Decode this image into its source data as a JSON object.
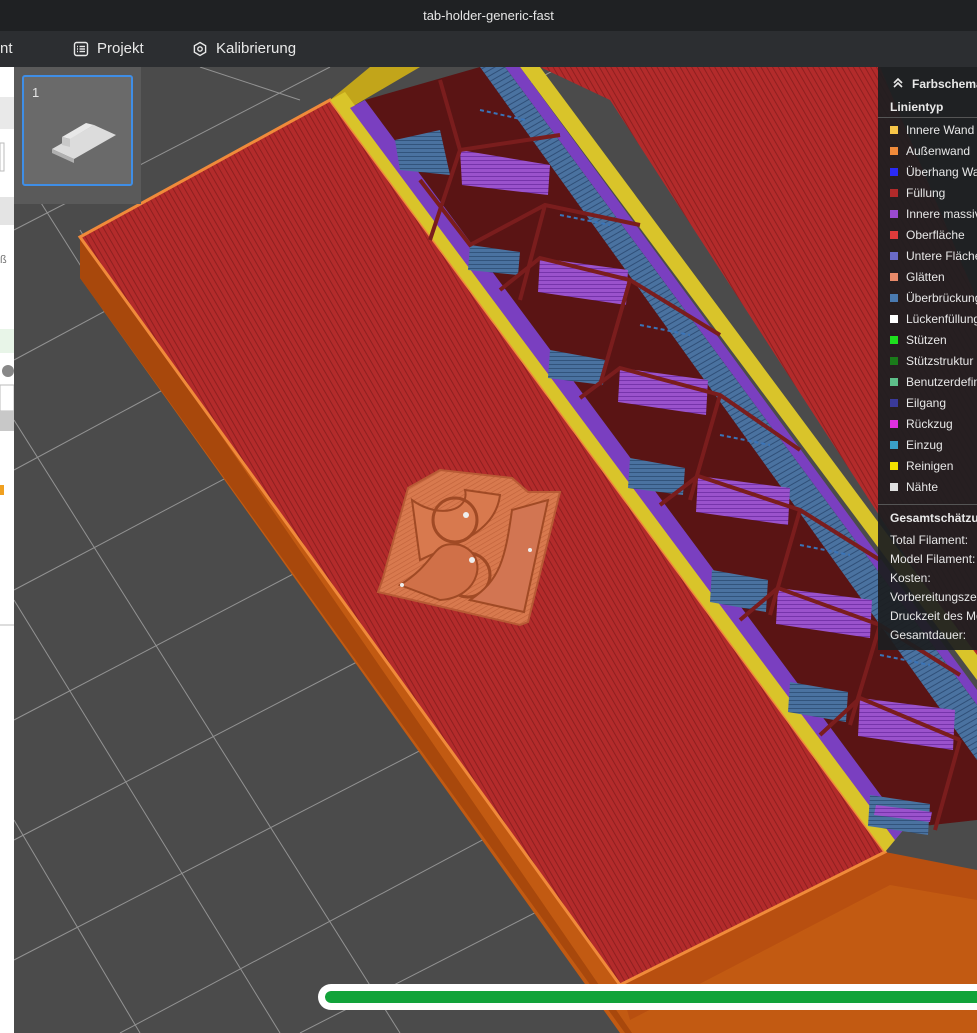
{
  "window": {
    "title": "tab-holder-generic-fast"
  },
  "menu": {
    "partial_left": "nt",
    "items": [
      {
        "label": "Projekt",
        "icon": "list-icon"
      },
      {
        "label": "Kalibrierung",
        "icon": "gear-icon"
      }
    ]
  },
  "plate_thumbnail": {
    "number": "1"
  },
  "legend": {
    "header": "Farbschema",
    "line_type_title": "Linientyp",
    "items": [
      {
        "label": "Innere Wand",
        "color": "#f7c548"
      },
      {
        "label": "Außenwand",
        "color": "#f08a3a"
      },
      {
        "label": "Überhang Wand",
        "color": "#2a2af5"
      },
      {
        "label": "Füllung",
        "color": "#b02a2a"
      },
      {
        "label": "Innere massive Füllung",
        "color": "#9b4ad0"
      },
      {
        "label": "Oberfläche",
        "color": "#e03b3b"
      },
      {
        "label": "Untere Fläche",
        "color": "#6a6ac8"
      },
      {
        "label": "Glätten",
        "color": "#e88a6a"
      },
      {
        "label": "Überbrückung",
        "color": "#4a7ab0"
      },
      {
        "label": "Lückenfüllung",
        "color": "#ffffff"
      },
      {
        "label": "Stützen",
        "color": "#1ee01e"
      },
      {
        "label": "Stützstruktur",
        "color": "#1a7a1a"
      },
      {
        "label": "Benutzerdefiniert",
        "color": "#5ebf8a"
      },
      {
        "label": "Eilgang",
        "color": "#3a3a9a"
      },
      {
        "label": "Rückzug",
        "color": "#e030e0"
      },
      {
        "label": "Einzug",
        "color": "#3aa0c8"
      },
      {
        "label": "Reinigen",
        "color": "#f0e000"
      },
      {
        "label": "Nähte",
        "color": "#e0e0e0"
      }
    ],
    "summary_title": "Gesamtschätzung",
    "summary": [
      "Total Filament:",
      "Model Filament:",
      "Kosten:",
      "Vorbereitungszeit:",
      "Druckzeit des Modells:",
      "Gesamtdauer:"
    ]
  },
  "progress": {
    "value": 1.0
  }
}
